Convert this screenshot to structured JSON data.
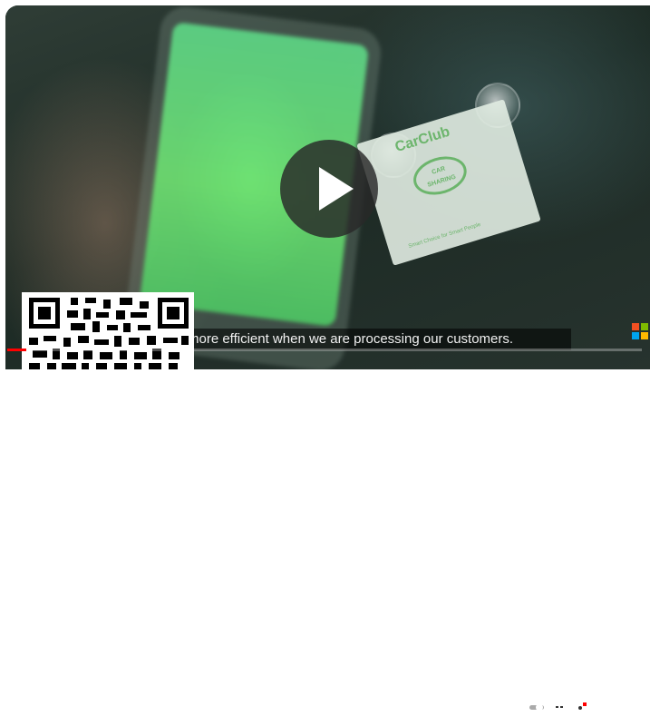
{
  "player": {
    "caption_text": "more efficient when we are processing our customers.",
    "progress": 0.03,
    "accent_color": "#ff0000"
  },
  "sticker": {
    "logo": "CarClub",
    "badge_line1": "CAR",
    "badge_line2": "SHARING",
    "tagline": "Smart Choice for Smart People"
  },
  "icons": {
    "play": "play-icon",
    "autoplay": "autoplay-toggle-icon",
    "captions": "cc-icon",
    "settings": "gear-icon",
    "miniplayer": "miniplayer-icon",
    "theater": "theater-icon",
    "fullscreen": "fullscreen-icon"
  }
}
